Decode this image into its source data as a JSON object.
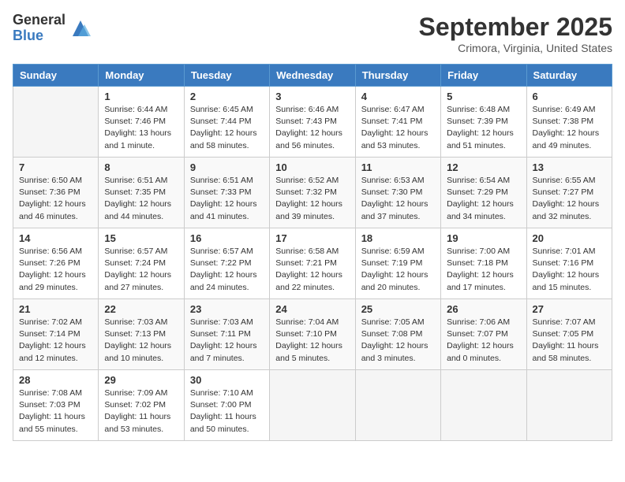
{
  "logo": {
    "general": "General",
    "blue": "Blue"
  },
  "title": {
    "month_year": "September 2025",
    "location": "Crimora, Virginia, United States"
  },
  "days_of_week": [
    "Sunday",
    "Monday",
    "Tuesday",
    "Wednesday",
    "Thursday",
    "Friday",
    "Saturday"
  ],
  "weeks": [
    [
      {
        "day": "",
        "info": ""
      },
      {
        "day": "1",
        "info": "Sunrise: 6:44 AM\nSunset: 7:46 PM\nDaylight: 13 hours\nand 1 minute."
      },
      {
        "day": "2",
        "info": "Sunrise: 6:45 AM\nSunset: 7:44 PM\nDaylight: 12 hours\nand 58 minutes."
      },
      {
        "day": "3",
        "info": "Sunrise: 6:46 AM\nSunset: 7:43 PM\nDaylight: 12 hours\nand 56 minutes."
      },
      {
        "day": "4",
        "info": "Sunrise: 6:47 AM\nSunset: 7:41 PM\nDaylight: 12 hours\nand 53 minutes."
      },
      {
        "day": "5",
        "info": "Sunrise: 6:48 AM\nSunset: 7:39 PM\nDaylight: 12 hours\nand 51 minutes."
      },
      {
        "day": "6",
        "info": "Sunrise: 6:49 AM\nSunset: 7:38 PM\nDaylight: 12 hours\nand 49 minutes."
      }
    ],
    [
      {
        "day": "7",
        "info": "Sunrise: 6:50 AM\nSunset: 7:36 PM\nDaylight: 12 hours\nand 46 minutes."
      },
      {
        "day": "8",
        "info": "Sunrise: 6:51 AM\nSunset: 7:35 PM\nDaylight: 12 hours\nand 44 minutes."
      },
      {
        "day": "9",
        "info": "Sunrise: 6:51 AM\nSunset: 7:33 PM\nDaylight: 12 hours\nand 41 minutes."
      },
      {
        "day": "10",
        "info": "Sunrise: 6:52 AM\nSunset: 7:32 PM\nDaylight: 12 hours\nand 39 minutes."
      },
      {
        "day": "11",
        "info": "Sunrise: 6:53 AM\nSunset: 7:30 PM\nDaylight: 12 hours\nand 37 minutes."
      },
      {
        "day": "12",
        "info": "Sunrise: 6:54 AM\nSunset: 7:29 PM\nDaylight: 12 hours\nand 34 minutes."
      },
      {
        "day": "13",
        "info": "Sunrise: 6:55 AM\nSunset: 7:27 PM\nDaylight: 12 hours\nand 32 minutes."
      }
    ],
    [
      {
        "day": "14",
        "info": "Sunrise: 6:56 AM\nSunset: 7:26 PM\nDaylight: 12 hours\nand 29 minutes."
      },
      {
        "day": "15",
        "info": "Sunrise: 6:57 AM\nSunset: 7:24 PM\nDaylight: 12 hours\nand 27 minutes."
      },
      {
        "day": "16",
        "info": "Sunrise: 6:57 AM\nSunset: 7:22 PM\nDaylight: 12 hours\nand 24 minutes."
      },
      {
        "day": "17",
        "info": "Sunrise: 6:58 AM\nSunset: 7:21 PM\nDaylight: 12 hours\nand 22 minutes."
      },
      {
        "day": "18",
        "info": "Sunrise: 6:59 AM\nSunset: 7:19 PM\nDaylight: 12 hours\nand 20 minutes."
      },
      {
        "day": "19",
        "info": "Sunrise: 7:00 AM\nSunset: 7:18 PM\nDaylight: 12 hours\nand 17 minutes."
      },
      {
        "day": "20",
        "info": "Sunrise: 7:01 AM\nSunset: 7:16 PM\nDaylight: 12 hours\nand 15 minutes."
      }
    ],
    [
      {
        "day": "21",
        "info": "Sunrise: 7:02 AM\nSunset: 7:14 PM\nDaylight: 12 hours\nand 12 minutes."
      },
      {
        "day": "22",
        "info": "Sunrise: 7:03 AM\nSunset: 7:13 PM\nDaylight: 12 hours\nand 10 minutes."
      },
      {
        "day": "23",
        "info": "Sunrise: 7:03 AM\nSunset: 7:11 PM\nDaylight: 12 hours\nand 7 minutes."
      },
      {
        "day": "24",
        "info": "Sunrise: 7:04 AM\nSunset: 7:10 PM\nDaylight: 12 hours\nand 5 minutes."
      },
      {
        "day": "25",
        "info": "Sunrise: 7:05 AM\nSunset: 7:08 PM\nDaylight: 12 hours\nand 3 minutes."
      },
      {
        "day": "26",
        "info": "Sunrise: 7:06 AM\nSunset: 7:07 PM\nDaylight: 12 hours\nand 0 minutes."
      },
      {
        "day": "27",
        "info": "Sunrise: 7:07 AM\nSunset: 7:05 PM\nDaylight: 11 hours\nand 58 minutes."
      }
    ],
    [
      {
        "day": "28",
        "info": "Sunrise: 7:08 AM\nSunset: 7:03 PM\nDaylight: 11 hours\nand 55 minutes."
      },
      {
        "day": "29",
        "info": "Sunrise: 7:09 AM\nSunset: 7:02 PM\nDaylight: 11 hours\nand 53 minutes."
      },
      {
        "day": "30",
        "info": "Sunrise: 7:10 AM\nSunset: 7:00 PM\nDaylight: 11 hours\nand 50 minutes."
      },
      {
        "day": "",
        "info": ""
      },
      {
        "day": "",
        "info": ""
      },
      {
        "day": "",
        "info": ""
      },
      {
        "day": "",
        "info": ""
      }
    ]
  ]
}
